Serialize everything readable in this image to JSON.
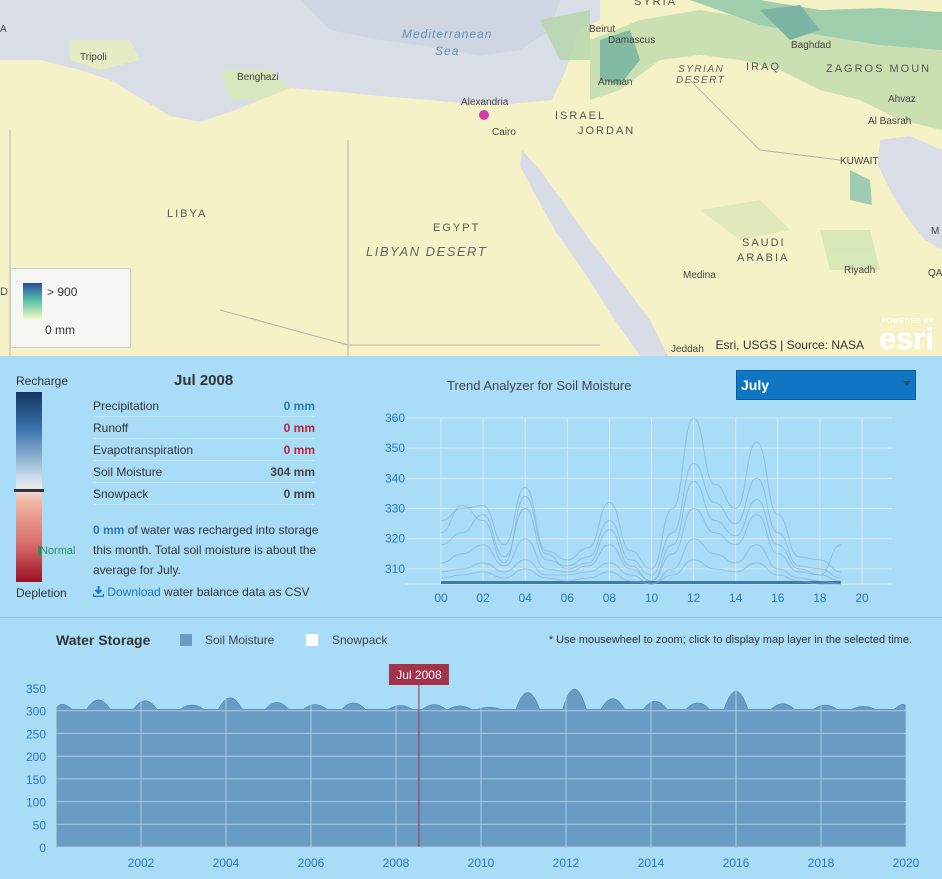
{
  "map": {
    "sea": [
      "Mediterranean",
      "Sea"
    ],
    "places": [
      {
        "name": "Syria",
        "text": "SYRIA",
        "kind": "region",
        "pos": [
          634,
          -4
        ]
      },
      {
        "name": "Tripoli",
        "text": "Tripoli",
        "kind": "place",
        "pos": [
          80,
          52
        ]
      },
      {
        "name": "Benghazi",
        "text": "Benghazi",
        "kind": "place",
        "pos": [
          237,
          72
        ]
      },
      {
        "name": "Beirut",
        "text": "Beirut",
        "kind": "place",
        "pos": [
          589,
          24
        ]
      },
      {
        "name": "Damascus",
        "text": "Damascus",
        "kind": "place",
        "pos": [
          608,
          35
        ]
      },
      {
        "name": "Baghdad",
        "text": "Baghdad",
        "kind": "place",
        "pos": [
          791,
          40
        ]
      },
      {
        "name": "Amman",
        "text": "Amman",
        "kind": "place",
        "pos": [
          598,
          77
        ]
      },
      {
        "name": "Alexandria",
        "text": "Alexandria",
        "kind": "place",
        "pos": [
          461,
          97
        ]
      },
      {
        "name": "Cairo",
        "text": "Cairo",
        "kind": "place",
        "pos": [
          492,
          127
        ]
      },
      {
        "name": "Ahvaz",
        "text": "Ahvaz",
        "kind": "place",
        "pos": [
          888,
          94
        ]
      },
      {
        "name": "Al Basrah",
        "text": "Al Basrah",
        "kind": "place",
        "pos": [
          868,
          116
        ]
      },
      {
        "name": "Kuwait",
        "text": "KUWAIT",
        "kind": "place",
        "pos": [
          840,
          156
        ]
      },
      {
        "name": "Medina",
        "text": "Medina",
        "kind": "place",
        "pos": [
          683,
          270
        ]
      },
      {
        "name": "Riyadh",
        "text": "Riyadh",
        "kind": "place",
        "pos": [
          844,
          265
        ]
      },
      {
        "name": "Jeddah",
        "text": "Jeddah",
        "kind": "place",
        "pos": [
          671,
          344
        ]
      },
      {
        "name": "Iraq",
        "text": "IRAQ",
        "kind": "region",
        "pos": [
          746,
          61
        ]
      },
      {
        "name": "Zagros",
        "text": "ZAGROS MOUN",
        "kind": "region",
        "pos": [
          826,
          63
        ]
      },
      {
        "name": "Syrian Desert 1",
        "text": "SYRIAN",
        "kind": "desert",
        "pos": [
          678,
          64
        ]
      },
      {
        "name": "Syrian Desert 2",
        "text": "DESERT",
        "kind": "desert",
        "pos": [
          676,
          75
        ]
      },
      {
        "name": "Israel",
        "text": "ISRAEL",
        "kind": "region",
        "pos": [
          555,
          110
        ]
      },
      {
        "name": "Jordan",
        "text": "JORDAN",
        "kind": "region",
        "pos": [
          578,
          125
        ]
      },
      {
        "name": "Libya",
        "text": "LIBYA",
        "kind": "region",
        "pos": [
          167,
          208
        ]
      },
      {
        "name": "Egypt",
        "text": "EGYPT",
        "kind": "region",
        "pos": [
          433,
          222
        ]
      },
      {
        "name": "Libyan Desert",
        "text": "LIBYAN DESERT",
        "kind": "desert",
        "pos": [
          366,
          244
        ]
      },
      {
        "name": "Saudi",
        "text": "SAUDI",
        "kind": "region",
        "pos": [
          742,
          237
        ]
      },
      {
        "name": "Arabia",
        "text": "ARABIA",
        "kind": "region",
        "pos": [
          737,
          252
        ]
      },
      {
        "name": "M",
        "text": "M",
        "kind": "place",
        "pos": [
          931,
          226
        ]
      },
      {
        "name": "Qa",
        "text": "QA",
        "kind": "place",
        "pos": [
          928,
          268
        ]
      },
      {
        "name": "A left",
        "text": "A",
        "kind": "place",
        "pos": [
          0,
          24
        ]
      },
      {
        "name": "D left",
        "text": "D",
        "kind": "region",
        "pos": [
          0,
          286
        ]
      }
    ],
    "legend": {
      "max_label": "> 900",
      "min_label": "0 mm"
    },
    "attribution": "Esri, USGS | Source: NASA",
    "logo": {
      "powered": "POWERED BY",
      "word": "esri"
    },
    "marker_color": "#d63aa8"
  },
  "balance": {
    "recharge_label": "Recharge",
    "depletion_label": "Depletion",
    "normal_label": "Normal",
    "date": "Jul 2008",
    "rows": [
      {
        "label": "Precipitation",
        "value": "0 mm",
        "tone": "blue"
      },
      {
        "label": "Runoff",
        "value": "0 mm",
        "tone": "red"
      },
      {
        "label": "Evapotranspiration",
        "value": "0 mm",
        "tone": "red"
      },
      {
        "label": "Soil Moisture",
        "value": "304 mm",
        "tone": "dark"
      },
      {
        "label": "Snowpack",
        "value": "0 mm",
        "tone": "dark"
      }
    ],
    "summary_value": "0 mm",
    "summary_text": " of water was recharged into storage this month. Total soil moisture is about the average for July.",
    "download_link": "Download",
    "download_text": " water balance data as CSV"
  },
  "trend": {
    "title": "Trend Analyzer for Soil Moisture",
    "month_selected": "July"
  },
  "storage": {
    "title": "Water Storage",
    "legend": [
      {
        "name": "Soil Moisture",
        "color": "#6a9bc3"
      },
      {
        "name": "Snowpack",
        "color": "#ffffff"
      }
    ],
    "hint": "* Use mousewheel to zoom; click to display map layer in the selected time.",
    "marker_label": "Jul 2008",
    "marker_color": "#a3334a"
  },
  "chart_data": [
    {
      "type": "line",
      "title": "Trend Analyzer for Soil Moisture",
      "x_tick_labels": [
        "00",
        "02",
        "04",
        "06",
        "08",
        "10",
        "12",
        "14",
        "16",
        "18",
        "20"
      ],
      "ylim": [
        305,
        360
      ],
      "y_ticks": [
        310,
        320,
        330,
        340,
        350,
        360
      ],
      "x": [
        0,
        1,
        2,
        3,
        4,
        5,
        6,
        7,
        8,
        9,
        10,
        11,
        12,
        13,
        14,
        15,
        16,
        17,
        18,
        19
      ],
      "series": [
        {
          "values": [
            326,
            330,
            331,
            318,
            337,
            316,
            313,
            317,
            332,
            316,
            310,
            330,
            360,
            338,
            330,
            352,
            328,
            314,
            313,
            309
          ]
        },
        {
          "values": [
            318,
            322,
            328,
            314,
            330,
            313,
            311,
            314,
            326,
            313,
            308,
            322,
            345,
            332,
            325,
            340,
            322,
            311,
            310,
            307
          ]
        },
        {
          "values": [
            312,
            315,
            318,
            311,
            320,
            310,
            309,
            311,
            318,
            310,
            306,
            315,
            330,
            322,
            318,
            328,
            315,
            309,
            308,
            306
          ]
        },
        {
          "values": [
            309,
            310,
            312,
            309,
            313,
            308,
            308,
            309,
            312,
            308,
            305,
            310,
            320,
            315,
            312,
            318,
            310,
            307,
            306,
            305
          ]
        },
        {
          "values": [
            307,
            308,
            309,
            307,
            310,
            307,
            306,
            307,
            309,
            306,
            305,
            308,
            313,
            310,
            309,
            312,
            308,
            306,
            305,
            305
          ]
        },
        {
          "values": [
            322,
            331,
            326,
            312,
            334,
            315,
            310,
            312,
            323,
            311,
            306,
            318,
            339,
            326,
            321,
            333,
            318,
            310,
            308,
            318
          ]
        }
      ]
    },
    {
      "type": "area",
      "title": "Water Storage",
      "ylim": [
        0,
        350
      ],
      "y_ticks": [
        0,
        50,
        100,
        150,
        200,
        250,
        300,
        350
      ],
      "x_ticks": [
        2002,
        2004,
        2006,
        2008,
        2010,
        2012,
        2014,
        2016,
        2018,
        2020
      ],
      "xlim": [
        2000,
        2020
      ],
      "series": [
        {
          "name": "Soil Moisture",
          "peaks": [
            [
              2000.1,
              315
            ],
            [
              2001.0,
              325
            ],
            [
              2002.1,
              323
            ],
            [
              2003.2,
              313
            ],
            [
              2004.1,
              330
            ],
            [
              2005.2,
              319
            ],
            [
              2006.1,
              314
            ],
            [
              2007.0,
              318
            ],
            [
              2008.1,
              312
            ],
            [
              2008.9,
              314
            ],
            [
              2009.5,
              311
            ],
            [
              2010.2,
              308
            ],
            [
              2011.1,
              342
            ],
            [
              2012.2,
              350
            ],
            [
              2013.1,
              328
            ],
            [
              2014.1,
              322
            ],
            [
              2015.1,
              318
            ],
            [
              2016.0,
              345
            ],
            [
              2017.1,
              316
            ],
            [
              2018.1,
              313
            ],
            [
              2019.0,
              310
            ],
            [
              2020.0,
              315
            ]
          ],
          "baseline": 303
        },
        {
          "name": "Snowpack",
          "values": [
            0
          ]
        }
      ],
      "selected": "Jul 2008",
      "selected_x": 2008.54
    }
  ]
}
